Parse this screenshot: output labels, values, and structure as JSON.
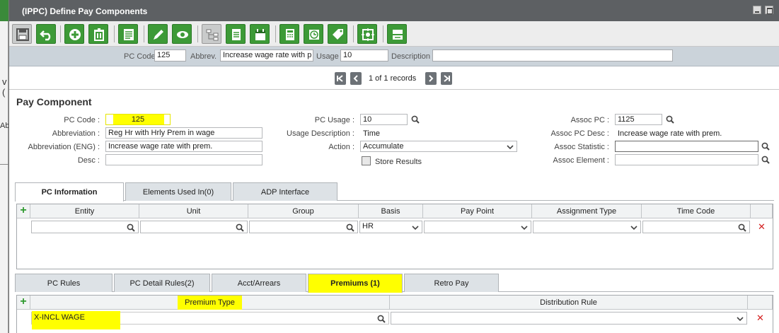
{
  "background_window": {
    "text1": "v (",
    "text2": "Abb"
  },
  "window": {
    "title": "(IPPC) Define Pay Components"
  },
  "toolbar": {
    "buttons": [
      "save-icon",
      "undo-icon",
      "add-icon",
      "delete-icon",
      "list-icon",
      "edit-icon",
      "view-icon",
      "tree-icon",
      "document-icon",
      "calendar-icon",
      "calculator-icon",
      "clock-icon",
      "tag-icon",
      "target-icon",
      "layout-icon"
    ]
  },
  "header": {
    "pc_code_label": "PC Code",
    "pc_code_value": "125",
    "abbrev_label": "Abbrev.",
    "abbrev_value": "Increase wage rate with p",
    "usage_label": "Usage",
    "usage_value": "10",
    "description_label": "Description",
    "description_value": ""
  },
  "nav": {
    "record_text": "1 of 1 records"
  },
  "section": {
    "title": "Pay Component"
  },
  "form": {
    "pc_code_label": "PC Code :",
    "pc_code_value": "125",
    "abbreviation_label": "Abbreviation :",
    "abbreviation_value": "Reg Hr with Hrly Prem in wage",
    "abbreviation_eng_label": "Abbreviation  (ENG) :",
    "abbreviation_eng_value": "Increase wage rate with prem.",
    "desc_label": "Desc :",
    "desc_value": "",
    "pc_usage_label": "PC Usage :",
    "pc_usage_value": "10",
    "usage_description_label": "Usage Description :",
    "usage_description_value": "Time",
    "action_label": "Action :",
    "action_value": "Accumulate",
    "store_results_label": "Store Results",
    "assoc_pc_label": "Assoc PC :",
    "assoc_pc_value": "1125",
    "assoc_pc_desc_label": "Assoc PC Desc :",
    "assoc_pc_desc_value": "Increase wage rate with prem.",
    "assoc_statistic_label": "Assoc Statistic :",
    "assoc_statistic_value": "",
    "assoc_element_label": "Assoc Element :",
    "assoc_element_value": ""
  },
  "tabs1": [
    {
      "label": "PC Information"
    },
    {
      "label": "Elements Used In(0)"
    },
    {
      "label": "ADP Interface"
    }
  ],
  "grid1": {
    "columns": [
      "Entity",
      "Unit",
      "Group",
      "Basis",
      "Pay Point",
      "Assignment Type",
      "Time Code"
    ],
    "row": {
      "basis": "HR"
    }
  },
  "tabs2": [
    {
      "label": "PC Rules"
    },
    {
      "label": "PC Detail Rules(2)"
    },
    {
      "label": "Acct/Arrears"
    },
    {
      "label": "Premiums  (1)"
    },
    {
      "label": "Retro Pay"
    }
  ],
  "grid2": {
    "columns": [
      "Premium Type",
      "Distribution Rule"
    ],
    "row": {
      "premium_type": "X-INCL WAGE",
      "distribution_rule": ""
    }
  },
  "colors": {
    "title_bar": "#5d6063",
    "toolbar_green": "#3d9a37",
    "header_bar": "#cbd3da",
    "highlight": "#ffff00",
    "delete_red": "#d42020"
  }
}
